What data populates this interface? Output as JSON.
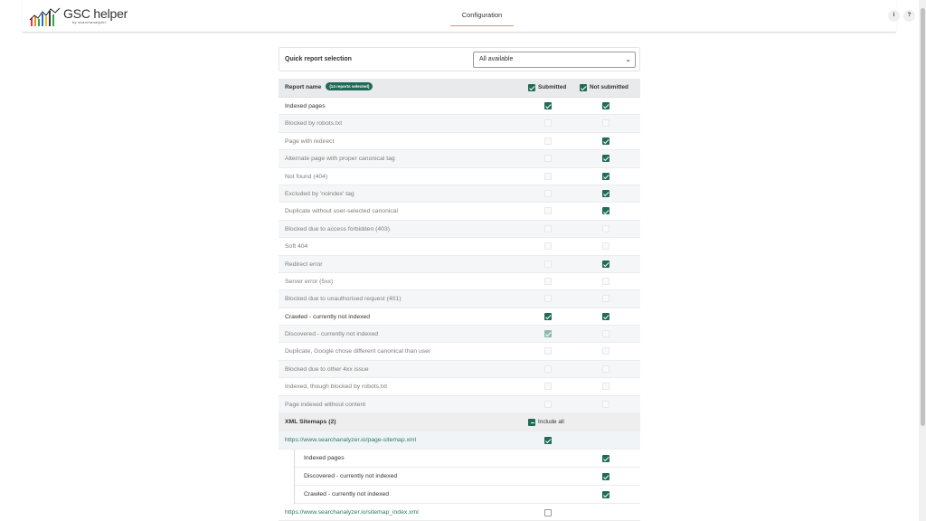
{
  "app": {
    "logo_title": "GSC helper",
    "logo_sub": "by searchanalyzer",
    "nav_tab": "Configuration",
    "info_btn": "i",
    "help_btn": "?"
  },
  "quick": {
    "label": "Quick report selection",
    "selected": "All available"
  },
  "table": {
    "header": {
      "name": "Report name",
      "badge": "(14 reports selected)",
      "submitted": "Submitted",
      "not_submitted": "Not submitted"
    },
    "rows": [
      {
        "name": "Indexed pages",
        "sub": "on",
        "not": "on",
        "style": "bold"
      },
      {
        "name": "Blocked by robots.txt",
        "sub": "faint",
        "not": "faint",
        "style": "dim"
      },
      {
        "name": "Page with redirect",
        "sub": "faint",
        "not": "on",
        "style": "dim"
      },
      {
        "name": "Alternate page with proper canonical tag",
        "sub": "faint",
        "not": "on",
        "style": "dim"
      },
      {
        "name": "Not found (404)",
        "sub": "faint",
        "not": "on",
        "style": "dim"
      },
      {
        "name": "Excluded by 'noindex' tag",
        "sub": "faint",
        "not": "on",
        "style": "dim"
      },
      {
        "name": "Duplicate without user-selected canonical",
        "sub": "faint",
        "not": "on",
        "style": "dim"
      },
      {
        "name": "Blocked due to access forbidden (403)",
        "sub": "faint",
        "not": "faint",
        "style": "dim"
      },
      {
        "name": "Soft 404",
        "sub": "faint",
        "not": "faint",
        "style": "dim"
      },
      {
        "name": "Redirect error",
        "sub": "faint",
        "not": "on",
        "style": "dim"
      },
      {
        "name": "Server error (5xx)",
        "sub": "faint",
        "not": "faint",
        "style": "dim"
      },
      {
        "name": "Blocked due to unauthorised request (401)",
        "sub": "faint",
        "not": "faint",
        "style": "dim"
      },
      {
        "name": "Crawled - currently not indexed",
        "sub": "on",
        "not": "on",
        "style": "bold"
      },
      {
        "name": "Discovered - currently not indexed",
        "sub": "faint-on",
        "not": "faint",
        "style": "dim"
      },
      {
        "name": "Duplicate, Google chose different canonical than user",
        "sub": "faint",
        "not": "faint",
        "style": "dim"
      },
      {
        "name": "Blocked due to other 4xx issue",
        "sub": "faint",
        "not": "faint",
        "style": "dim"
      },
      {
        "name": "Indexed, though blocked by robots.txt",
        "sub": "faint",
        "not": "faint",
        "style": "dim"
      },
      {
        "name": "Page indexed without content",
        "sub": "faint",
        "not": "faint",
        "style": "dim"
      }
    ],
    "sitemaps": {
      "label": "XML Sitemaps (2)",
      "include_all": "Include all",
      "items": [
        {
          "url": "https://www.searchanalyzer.io/page-sitemap.xml",
          "checked": true,
          "children": [
            "Indexed pages",
            "Discovered - currently not indexed",
            "Crawled - currently not indexed"
          ]
        },
        {
          "url": "https://www.searchanalyzer.io/sitemap_index.xml",
          "checked": false
        }
      ]
    }
  },
  "colors": {
    "accent": "#1f6b57",
    "tab_underline": "#c9a06a"
  }
}
